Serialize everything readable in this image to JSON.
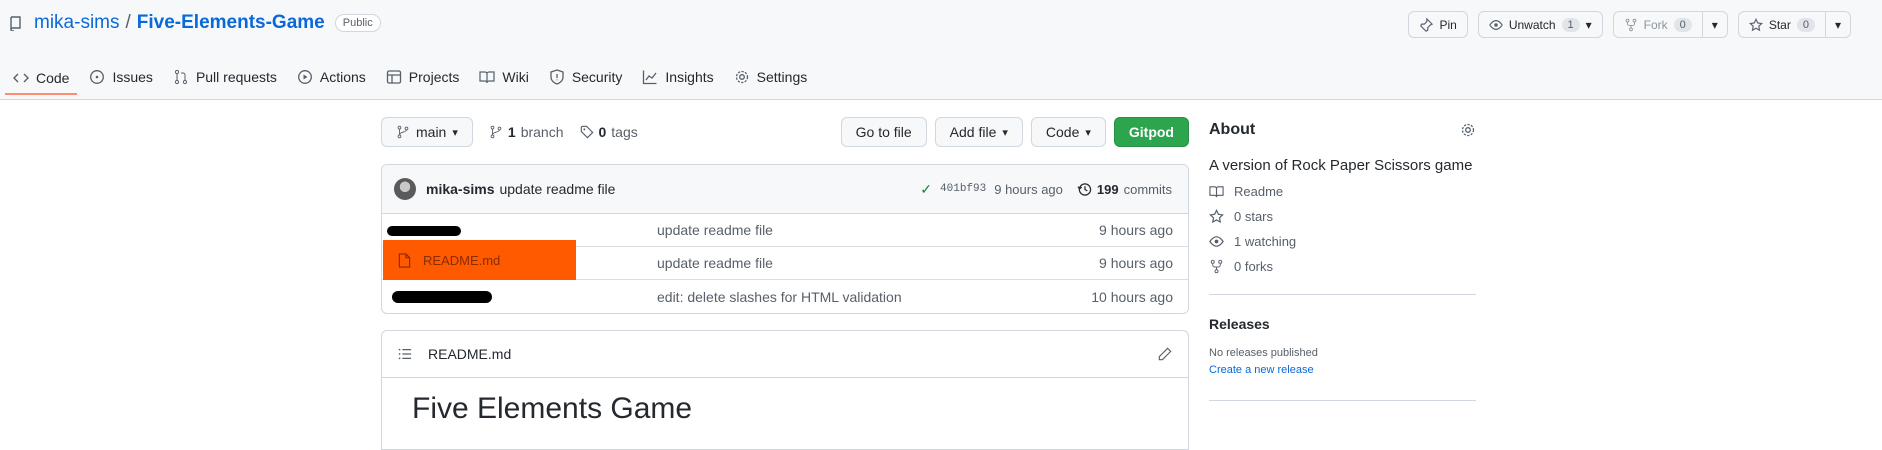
{
  "repo": {
    "owner": "mika-sims",
    "separator": "/",
    "name": "Five-Elements-Game",
    "visibility": "Public"
  },
  "header_buttons": {
    "pin": "Pin",
    "unwatch": "Unwatch",
    "unwatch_count": "1",
    "fork": "Fork",
    "fork_count": "0",
    "star": "Star",
    "star_count": "0"
  },
  "tabs": [
    {
      "label": "Code",
      "icon": "code-icon",
      "active": true
    },
    {
      "label": "Issues",
      "icon": "issue-icon"
    },
    {
      "label": "Pull requests",
      "icon": "pull-request-icon"
    },
    {
      "label": "Actions",
      "icon": "play-icon"
    },
    {
      "label": "Projects",
      "icon": "table-icon"
    },
    {
      "label": "Wiki",
      "icon": "book-icon"
    },
    {
      "label": "Security",
      "icon": "shield-icon"
    },
    {
      "label": "Insights",
      "icon": "graph-icon"
    },
    {
      "label": "Settings",
      "icon": "gear-icon"
    }
  ],
  "toolbar": {
    "branch": "main",
    "branch_count": "1",
    "branch_label": "branch",
    "tag_count": "0",
    "tag_label": "tags",
    "go_to_file": "Go to file",
    "add_file": "Add file",
    "code": "Code",
    "gitpod": "Gitpod"
  },
  "latest_commit": {
    "author": "mika-sims",
    "message": "update readme file",
    "sha": "401bf93",
    "age": "9 hours ago",
    "commit_count": "199",
    "commit_label": "commits"
  },
  "files": [
    {
      "name": "",
      "message": "update readme file",
      "age": "9 hours ago",
      "redacted": true
    },
    {
      "name": "README.md",
      "message": "update readme file",
      "age": "9 hours ago",
      "highlighted": true
    },
    {
      "name": "",
      "message": "edit: delete slashes for HTML validation",
      "age": "10 hours ago",
      "redacted": true
    }
  ],
  "readme": {
    "filename": "README.md",
    "heading": "Five Elements Game"
  },
  "about": {
    "title": "About",
    "description": "A version of Rock Paper Scissors game",
    "readme": "Readme",
    "stars": "0 stars",
    "watching": "1 watching",
    "forks": "0 forks"
  },
  "releases": {
    "title": "Releases",
    "none": "No releases published",
    "create": "Create a new release"
  },
  "colors": {
    "link": "#0969da",
    "gitpod_green": "#2da44e",
    "highlight_orange": "#ff5a00",
    "tab_underline": "#fd8c73"
  }
}
